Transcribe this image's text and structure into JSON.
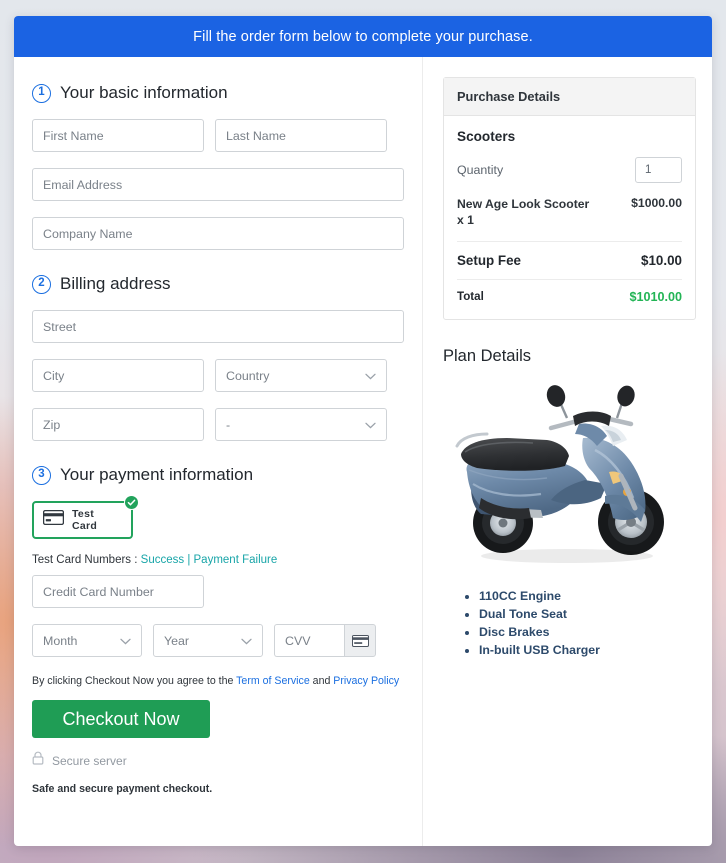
{
  "banner": {
    "text": "Fill the order form below to complete your purchase."
  },
  "sections": {
    "basic": {
      "num": "1",
      "title": "Your basic information"
    },
    "billing": {
      "num": "2",
      "title": "Billing address"
    },
    "payment": {
      "num": "3",
      "title": "Your payment information"
    }
  },
  "fields": {
    "first_name": {
      "placeholder": "First Name",
      "value": ""
    },
    "last_name": {
      "placeholder": "Last Name",
      "value": ""
    },
    "email": {
      "placeholder": "Email Address",
      "value": ""
    },
    "company": {
      "placeholder": "Company Name",
      "value": ""
    },
    "street": {
      "placeholder": "Street",
      "value": ""
    },
    "city": {
      "placeholder": "City",
      "value": ""
    },
    "country": {
      "placeholder": "Country",
      "value": ""
    },
    "zip": {
      "placeholder": "Zip",
      "value": ""
    },
    "state": {
      "placeholder": "-",
      "value": ""
    },
    "credit_card": {
      "placeholder": "Credit Card Number",
      "value": ""
    },
    "month": {
      "placeholder": "Month",
      "value": ""
    },
    "year": {
      "placeholder": "Year",
      "value": ""
    },
    "cvv": {
      "placeholder": "CVV",
      "value": ""
    }
  },
  "payment": {
    "card_option_label": "Test  Card",
    "selected": true,
    "test_numbers_prefix": "Test Card Numbers : ",
    "test_success_link": "Success",
    "test_separator": " | ",
    "test_failure_link": "Payment Failure",
    "terms_prefix": "By clicking Checkout Now you agree to the ",
    "terms_link": "Term of Service",
    "terms_mid": " and ",
    "privacy_link": "Privacy Policy",
    "checkout_label": "Checkout Now",
    "secure_label": "Secure server",
    "safe_note": "Safe and secure payment checkout."
  },
  "purchase": {
    "header": "Purchase Details",
    "product_group": "Scooters",
    "quantity_label": "Quantity",
    "quantity_value": "1",
    "line_item_name": "New Age Look Scooter x 1",
    "line_item_amount": "$1000.00",
    "setup_fee_label": "Setup Fee",
    "setup_fee_amount": "$10.00",
    "total_label": "Total",
    "total_amount": "$1010.00"
  },
  "plan": {
    "title": "Plan Details",
    "features": [
      "110CC Engine",
      "Dual Tone Seat",
      "Disc Brakes",
      "In-built USB Charger"
    ]
  },
  "colors": {
    "banner_blue": "#1b63e3",
    "step_blue": "#1b6fe0",
    "selected_green": "#22a35c",
    "checkout_green": "#1f9d55",
    "total_green": "#22b455",
    "test_link_teal": "#18a5a8",
    "link_blue": "#1b6fe0",
    "feature_navy": "#2d4a6b"
  }
}
